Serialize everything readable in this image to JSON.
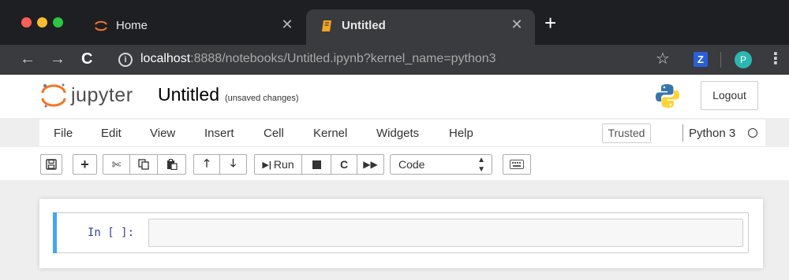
{
  "browser": {
    "tabs": [
      {
        "title": "Home"
      },
      {
        "title": "Untitled"
      }
    ],
    "address": {
      "host": "localhost",
      "rest": ":8888/notebooks/Untitled.ipynb?kernel_name=python3"
    },
    "extension_label": "Z",
    "profile_initial": "P"
  },
  "header": {
    "wordmark": "jupyter",
    "notebook_title": "Untitled",
    "save_status": "(unsaved changes)",
    "logout_label": "Logout"
  },
  "menubar": {
    "items": [
      "File",
      "Edit",
      "View",
      "Insert",
      "Cell",
      "Kernel",
      "Widgets",
      "Help"
    ],
    "trusted_label": "Trusted",
    "kernel_name": "Python 3"
  },
  "toolbar": {
    "run_label": "Run",
    "cell_type": "Code"
  },
  "cell": {
    "prompt": "In [ ]:"
  },
  "colors": {
    "tabbar_bg": "#1e1f22",
    "active_tab_bg": "#3a3b3e",
    "jupyter_orange": "#f37626",
    "cell_selected_bar": "#42a5f5",
    "prompt_blue": "#303f9f"
  }
}
